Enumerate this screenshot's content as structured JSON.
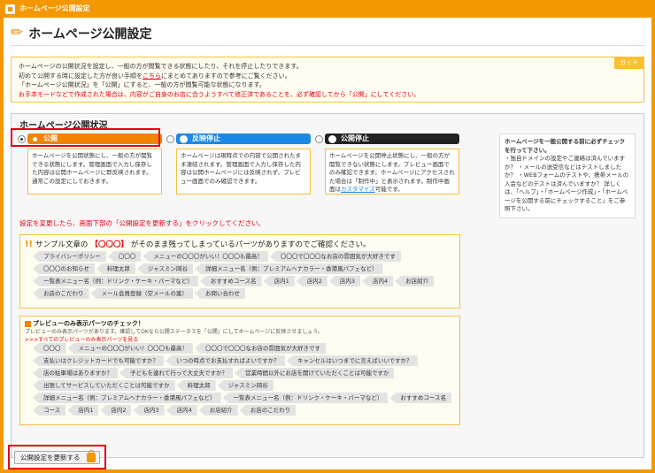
{
  "topbar": {
    "title": "ホームページ公開設定"
  },
  "page": {
    "title": "ホームページ公開設定"
  },
  "guide": {
    "badge": "ガイド",
    "line1": "ホームページの公開状況を設定し、一般の方が閲覧できる状態にしたり、それを停止したりできます。",
    "line2a": "初めて公開する時に設定した方が良い手順を",
    "line2link": "こちら",
    "line2b": "にまとめてありますので参考にご覧ください。",
    "line3": "「ホームページ公開状況」を「公開」にすると、一般の方が閲覧可能な状態になります。",
    "line4": "お手本モードなどで作成された場合は、内容がご自身のお店に合うようすべて修正済であることを、必ず確認してから「公開」にしてください。"
  },
  "panel": {
    "title": "ホームページ公開状況"
  },
  "statuses": [
    {
      "label": "公開",
      "desc": "ホームページを公開状態にし、一般の方が閲覧できる状態にします。管理画面で入力し保存した内容は公開ホームページに即反映されます。通常この設定にしておきます。"
    },
    {
      "label": "反映停止",
      "desc": "ホームページは現時点での内容で公開されたまま凍結されます。管理画面で入力し保存した内容は公開ホームページには反映されず、プレビュー画面でのみ確認できます。"
    },
    {
      "label": "公開停止",
      "desc_a": "ホームページを公開停止状態にし、一般の方が閲覧できない状態にします。プレビュー画面でのみ確認できます。ホームページにアクセスされた場合は「制作中」と表示されます。制作中画面は",
      "desc_link": "カスタマイズ",
      "desc_b": "可能です。"
    }
  ],
  "side": {
    "head": "ホームページを一般公開する前に必ずチェックを行って下さい。",
    "body": "・独自ドメインの設定やご連絡は済んでいますか？ ・メールの送受信などはテストしましたか？ ・WEBフォームのテストや、携帯メールの入会などのテストは済んでいますか？ 詳しくは、「ヘルプ」・「ホームページ作成」・「ホームページを公開する前にチェックすること」をご参照下さい。"
  },
  "notice": "設定を変更したら、画面下部の「公開設定を更新する」をクリックしてください。",
  "box1": {
    "head_a": "サンプル文章の",
    "head_red": "【〇〇〇】",
    "head_b": "がそのまま残ってしまっているパーツがありますのでご確認ください。",
    "tags": [
      "プライバシーポリシー",
      "〇〇〇",
      "メニューの〇〇〇がいい！〇〇〇も最高！",
      "〇〇〇で〇〇〇なお店の雰囲気が大好きです",
      "〇〇〇のお知らせ",
      "料理太郎",
      "ジャスミン岡谷",
      "詳細メニュー名（例：プレミアムヘナカラー・香港風パフェなど）",
      "一覧表メニュー名（例：ドリンク・ケーキ・パーマなど）",
      "おすすめコース名",
      "店内1",
      "店内2",
      "店内3",
      "店内4",
      "お店紹介",
      "お店のこだわり",
      "メール会員登録（空メールの案）",
      "お問い合わせ"
    ]
  },
  "box2": {
    "head": "プレビューのみ表示パーツのチェック！",
    "sub": "プレビューのみ表示パーツがあります。確認してOKなら公開ステータスを「公開」にしてホームページに反映させましょう。",
    "link": ">>>すべてのプレビューのみ表示パーツを見る",
    "tags": [
      "〇〇〇",
      "メニューの〇〇〇がいい！〇〇〇も最高！",
      "〇〇〇で〇〇〇なお店の雰囲気が大好きです",
      "支払いはクレジットカードでも可能ですか？",
      "いつの時点でお支払すればよいですか？",
      "キャンセルはいつまでに言えばいいですか？",
      "店の駐車場はありますか？",
      "子どもを連れて行って大丈夫ですか？",
      "営業時間以外にお店を開けていただくことは可能ですか",
      "出張してサービスしていただくことは可能ですか",
      "料理太郎",
      "ジャスミン岡谷",
      "詳細メニュー名（例：プレミアムヘナカラー・香港風パフェなど）",
      "一覧表メニュー名（例：ドリンク・ケーキ・パーマなど）",
      "おすすめコース名",
      "コース",
      "店内1",
      "店内2",
      "店内3",
      "店内4",
      "お店紹介",
      "お店のこだわり"
    ]
  },
  "update": {
    "label": "公開設定を更新する"
  },
  "colors": {
    "accent": "#f39800",
    "alert": "#e60012",
    "link": "#1e88e5"
  }
}
